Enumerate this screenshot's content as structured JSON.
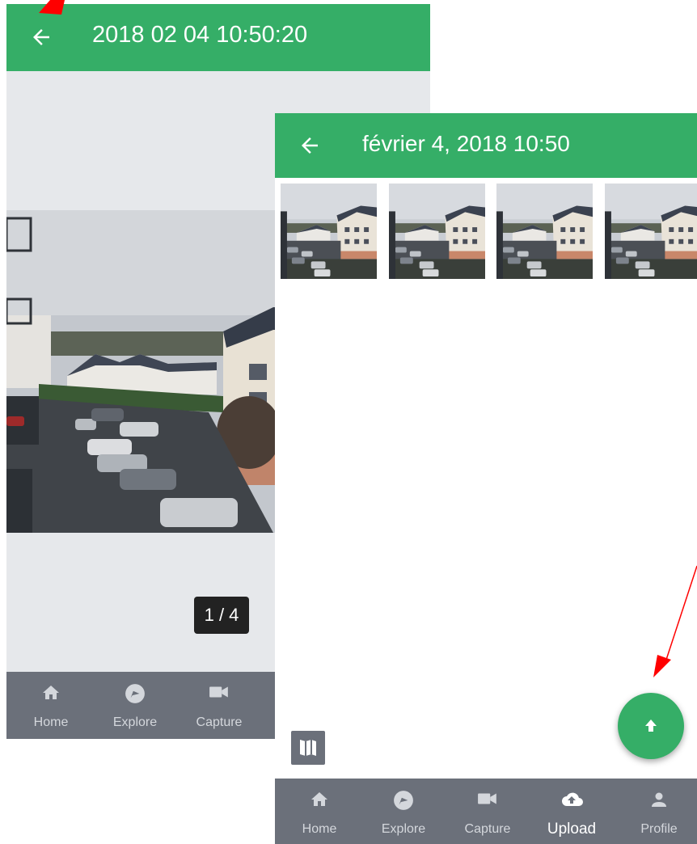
{
  "viewer_screen": {
    "title": "2018 02 04 10:50:20",
    "counter": "1 / 4",
    "nav": [
      {
        "label": "Home",
        "icon": "home-icon"
      },
      {
        "label": "Explore",
        "icon": "compass-icon"
      },
      {
        "label": "Capture",
        "icon": "video-camera-icon"
      }
    ]
  },
  "upload_screen": {
    "title": "février 4, 2018 10:50",
    "thumbnails": 4,
    "map_button_icon": "map-icon",
    "fab_icon": "arrow-up-icon",
    "nav": [
      {
        "label": "Home",
        "icon": "home-icon"
      },
      {
        "label": "Explore",
        "icon": "compass-icon"
      },
      {
        "label": "Capture",
        "icon": "video-camera-icon"
      },
      {
        "label": "Upload",
        "icon": "cloud-upload-icon",
        "active": true
      },
      {
        "label": "Profile",
        "icon": "person-icon"
      }
    ]
  },
  "colors": {
    "primary": "#35ae67",
    "nav_background": "#6b707a",
    "viewer_background": "#e6e8eb",
    "annotation_arrow": "#ff0000"
  }
}
